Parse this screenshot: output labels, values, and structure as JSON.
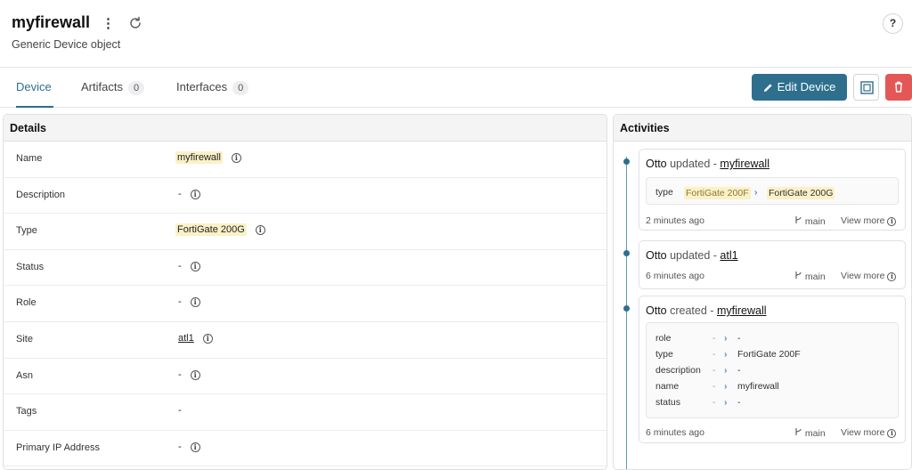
{
  "header": {
    "title": "myfirewall",
    "subtitle": "Generic Device object",
    "help": "?"
  },
  "tabs": [
    {
      "label": "Device"
    },
    {
      "label": "Artifacts",
      "count": "0"
    },
    {
      "label": "Interfaces",
      "count": "0"
    }
  ],
  "toolbar": {
    "edit_label": "Edit Device"
  },
  "details": {
    "heading": "Details",
    "rows": [
      {
        "label": "Name",
        "value": "myfirewall"
      },
      {
        "label": "Description",
        "value": "-"
      },
      {
        "label": "Type",
        "value": "FortiGate 200G"
      },
      {
        "label": "Status",
        "value": "-"
      },
      {
        "label": "Role",
        "value": "-"
      },
      {
        "label": "Site",
        "value": "atl1"
      },
      {
        "label": "Asn",
        "value": "-"
      },
      {
        "label": "Tags",
        "value": "-"
      },
      {
        "label": "Primary IP Address",
        "value": "-"
      }
    ]
  },
  "activities": {
    "heading": "Activities",
    "items": [
      {
        "actor": "Otto",
        "verb": "updated -",
        "target": "myfirewall",
        "time": "2 minutes ago",
        "branch": "main",
        "view_more": "View more",
        "changes": [
          {
            "key": "type",
            "old": "FortiGate 200F",
            "new": "FortiGate 200G"
          }
        ]
      },
      {
        "actor": "Otto",
        "verb": "updated -",
        "target": "atl1",
        "time": "6 minutes ago",
        "branch": "main",
        "view_more": "View more"
      },
      {
        "actor": "Otto",
        "verb": "created -",
        "target": "myfirewall",
        "time": "6 minutes ago",
        "branch": "main",
        "view_more": "View more",
        "changes": [
          {
            "key": "role",
            "old": "-",
            "new": "-"
          },
          {
            "key": "type",
            "old": "-",
            "new": "FortiGate 200F"
          },
          {
            "key": "description",
            "old": "-",
            "new": "-"
          },
          {
            "key": "name",
            "old": "-",
            "new": "myfirewall"
          },
          {
            "key": "status",
            "old": "-",
            "new": "-"
          }
        ]
      }
    ]
  },
  "colors": {
    "accent": "#2e6f8e",
    "danger": "#e45757",
    "highlight": "#fbf1c7"
  }
}
